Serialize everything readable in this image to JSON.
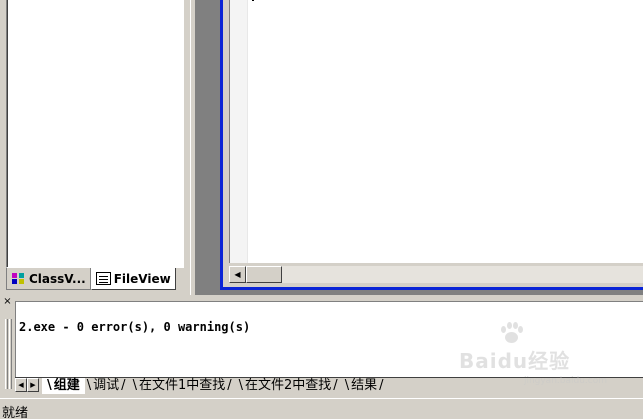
{
  "workspace": {
    "tabs": [
      {
        "label": "ClassV...",
        "icon": "classview-icon"
      },
      {
        "label": "FileView",
        "icon": "fileview-icon"
      }
    ]
  },
  "output": {
    "message": "2.exe - 0 error(s), 0 warning(s)",
    "tabs": [
      {
        "label": "组建"
      },
      {
        "label": "调试"
      },
      {
        "label": "在文件1中查找"
      },
      {
        "label": "在文件2中查找"
      },
      {
        "label": "结果"
      }
    ],
    "close_symbol": "×"
  },
  "status": {
    "text": "就绪"
  },
  "watermark": {
    "text": "Baidu经验",
    "url": "jingyan.baidu.com"
  },
  "colors": {
    "window_frame_active": "#0a24d6",
    "mdi_background": "#808080",
    "face": "#d4d0c8"
  }
}
